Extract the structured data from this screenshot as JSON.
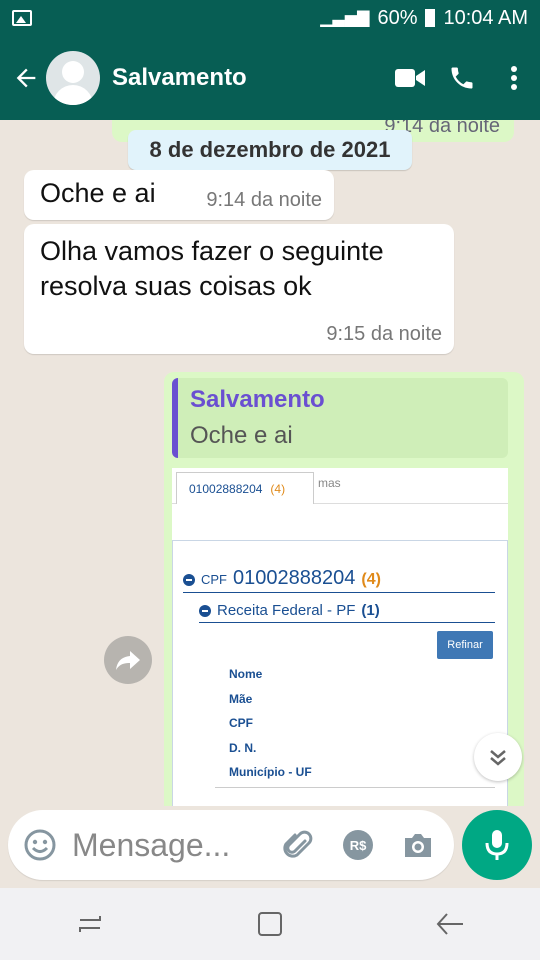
{
  "status": {
    "signal": "60%",
    "time": "10:04 AM"
  },
  "header": {
    "title": "Salvamento"
  },
  "chat": {
    "prev_out_time": "9:14 da noite",
    "date_chip": "8 de dezembro de 2021",
    "messages": [
      {
        "text": "Oche e ai",
        "time": "9:14 da noite"
      },
      {
        "text": "Olha vamos fazer o seguinte resolva suas coisas ok",
        "time": "9:15 da noite"
      }
    ],
    "quote": {
      "name": "Salvamento",
      "text": "Oche e ai"
    },
    "screenshot": {
      "tab_label": "01002888204",
      "tab_count": "(4)",
      "tab_extra": "mas",
      "cpf_label": "CPF",
      "cpf_number": "01002888204",
      "cpf_count": "(4)",
      "rf_label": "Receita Federal - PF",
      "rf_count": "(1)",
      "button": "Refinar",
      "fields": [
        "Nome",
        "Mãe",
        "CPF",
        "D. N.",
        "Município - UF"
      ]
    }
  },
  "input": {
    "placeholder": "Mensage..."
  },
  "colors": {
    "header": "#075e54",
    "outgoing": "#dcf8c6",
    "mic": "#00a884"
  }
}
